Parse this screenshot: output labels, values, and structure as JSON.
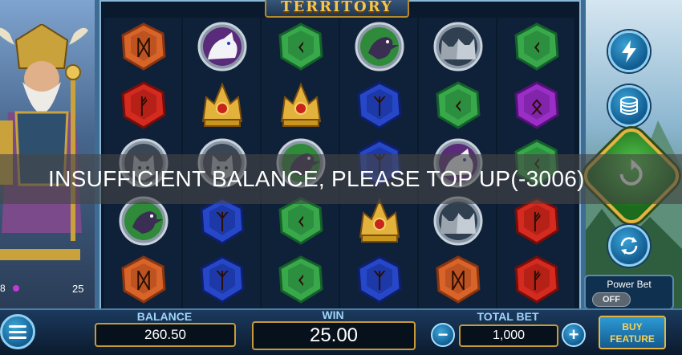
{
  "game": {
    "title": "TERRITORY"
  },
  "reels": {
    "columns": [
      [
        "rune-orange",
        "rune-red",
        "wolf-head",
        "raven",
        "rune-orange"
      ],
      [
        "white-wolf",
        "gold-helmet",
        "wolf-head",
        "rune-blue",
        "rune-blue"
      ],
      [
        "rune-green",
        "gold-helmet",
        "raven",
        "rune-green",
        "rune-green"
      ],
      [
        "raven",
        "rune-blue",
        "rune-blue",
        "gold-helmet",
        "rune-blue"
      ],
      [
        "wolf-pair",
        "rune-green",
        "white-wolf",
        "wolf-pair",
        "rune-orange"
      ],
      [
        "rune-green",
        "rune-purple",
        "rune-green",
        "rune-red",
        "rune-red"
      ]
    ]
  },
  "left_panel": {
    "stat_left": "8",
    "stat_right": "25"
  },
  "side_controls": {
    "turbo_icon": "lightning-icon",
    "bet_icon": "coin-stack-icon",
    "spin_icon": "spin-arrow-icon",
    "autoplay_icon": "autoplay-icon",
    "power_bet_label": "Power Bet",
    "power_bet_state": "OFF"
  },
  "bottom_bar": {
    "balance_label": "BALANCE",
    "balance_value": "260.50",
    "win_label": "WIN",
    "win_value": "25.00",
    "total_bet_label": "TOTAL BET",
    "total_bet_value": "1,000",
    "minus_label": "−",
    "plus_label": "+",
    "buy_feature_line1": "BUY",
    "buy_feature_line2": "FEATURE"
  },
  "toast": {
    "message": "INSUFFICIENT BALANCE, PLEASE TOP UP(-3006)"
  },
  "colors": {
    "gold": "#e3b43e",
    "accent_blue": "#2c9ad4",
    "spin_green": "#53c44a"
  }
}
